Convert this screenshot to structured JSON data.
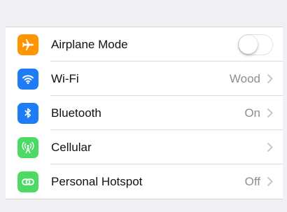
{
  "settings": {
    "rows": [
      {
        "label": "Airplane Mode",
        "icon": "airplane-icon",
        "color": "#ff9500",
        "toggle": false
      },
      {
        "label": "Wi-Fi",
        "icon": "wifi-icon",
        "color": "#1e7cf6",
        "value": "Wood"
      },
      {
        "label": "Bluetooth",
        "icon": "bluetooth-icon",
        "color": "#1e7cf6",
        "value": "On"
      },
      {
        "label": "Cellular",
        "icon": "cellular-icon",
        "color": "#4cd964",
        "value": ""
      },
      {
        "label": "Personal Hotspot",
        "icon": "hotspot-icon",
        "color": "#4cd964",
        "value": "Off"
      }
    ]
  }
}
